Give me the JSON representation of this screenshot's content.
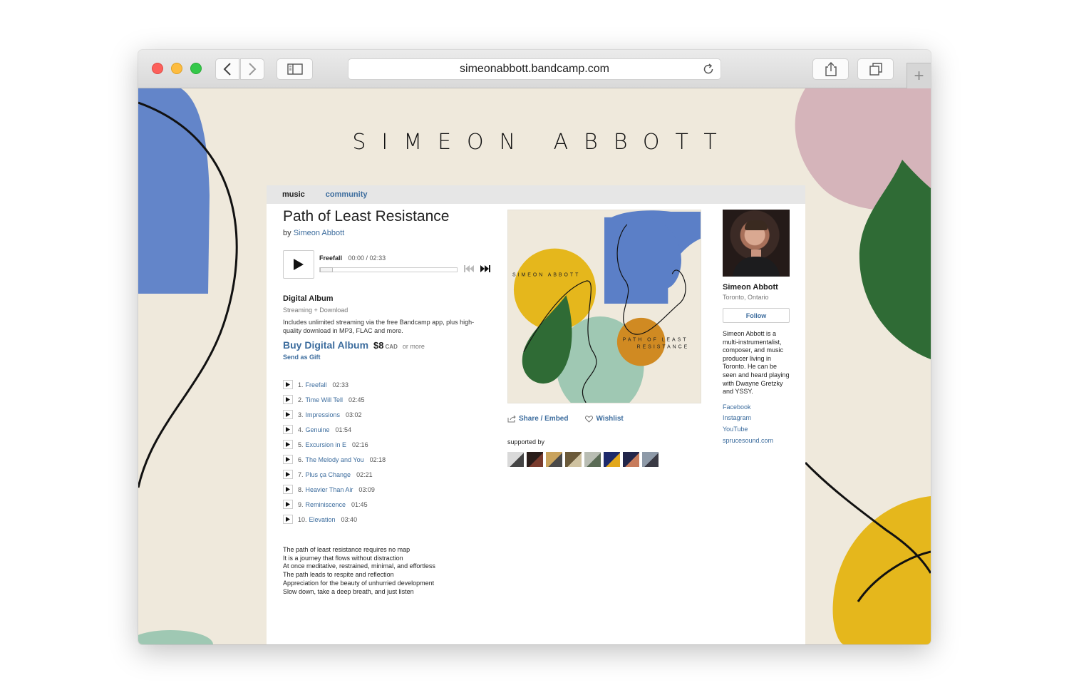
{
  "browser": {
    "url": "simeonabbott.bandcamp.com",
    "new_tab_label": "+"
  },
  "site": {
    "banner_title": "SIMEON ABBOTT",
    "nav": {
      "music": "music",
      "community": "community"
    }
  },
  "album": {
    "title": "Path of Least Resistance",
    "by_prefix": "by",
    "artist": "Simeon Abbott",
    "player": {
      "track": "Freefall",
      "time": "00:00 / 02:33",
      "progress": 0
    },
    "purchase": {
      "format": "Digital Album",
      "subtitle": "Streaming + Download",
      "description": "Includes unlimited streaming via the free Bandcamp app, plus high-quality download in MP3, FLAC and more.",
      "buy_label": "Buy Digital Album",
      "price": "$8",
      "currency": "CAD",
      "or_more": "or more",
      "gift_label": "Send as Gift"
    },
    "tracks": [
      {
        "num": "1.",
        "name": "Freefall",
        "duration": "02:33"
      },
      {
        "num": "2.",
        "name": "Time Will Tell",
        "duration": "02:45"
      },
      {
        "num": "3.",
        "name": "Impressions",
        "duration": "03:02"
      },
      {
        "num": "4.",
        "name": "Genuine",
        "duration": "01:54"
      },
      {
        "num": "5.",
        "name": "Excursion in E",
        "duration": "02:16"
      },
      {
        "num": "6.",
        "name": "The Melody and You",
        "duration": "02:18"
      },
      {
        "num": "7.",
        "name": "Plus ça Change",
        "duration": "02:21"
      },
      {
        "num": "8.",
        "name": "Heavier Than Air",
        "duration": "03:09"
      },
      {
        "num": "9.",
        "name": "Reminiscence",
        "duration": "01:45"
      },
      {
        "num": "10.",
        "name": "Elevation",
        "duration": "03:40"
      }
    ],
    "about_lines": [
      "The path of least resistance requires no map",
      "It is a journey that flows without distraction",
      "At once meditative, restrained, minimal, and effortless",
      "The path leads to respite and reflection",
      "Appreciation for the beauty of unhurried development",
      "Slow down, take a deep breath, and just listen"
    ],
    "cover": {
      "artist_text": "SIMEON ABBOTT",
      "title_line1": "PATH OF LEAST",
      "title_line2": "RESISTANCE"
    },
    "share_label": "Share / Embed",
    "wishlist_label": "Wishlist",
    "supported_by_label": "supported by",
    "supporter_count": 8
  },
  "artist_panel": {
    "name": "Simeon Abbott",
    "location": "Toronto, Ontario",
    "follow_label": "Follow",
    "bio": "Simeon Abbott is a multi-instrumentalist, composer, and music producer living in Toronto. He can be seen and heard playing with Dwayne Gretzky and YSSY.",
    "links": [
      "Facebook",
      "Instagram",
      "YouTube",
      "sprucesound.com"
    ]
  },
  "colors": {
    "link": "#3d6d9e",
    "background": "#efe9dc",
    "blue_shape": "#5b7fc7",
    "yellow_shape": "#e5b71c",
    "green_shape": "#2f6b35",
    "pink_shape": "#d2aeb6",
    "orange_shape": "#d08a22",
    "mint_shape": "#9fc8b3"
  }
}
